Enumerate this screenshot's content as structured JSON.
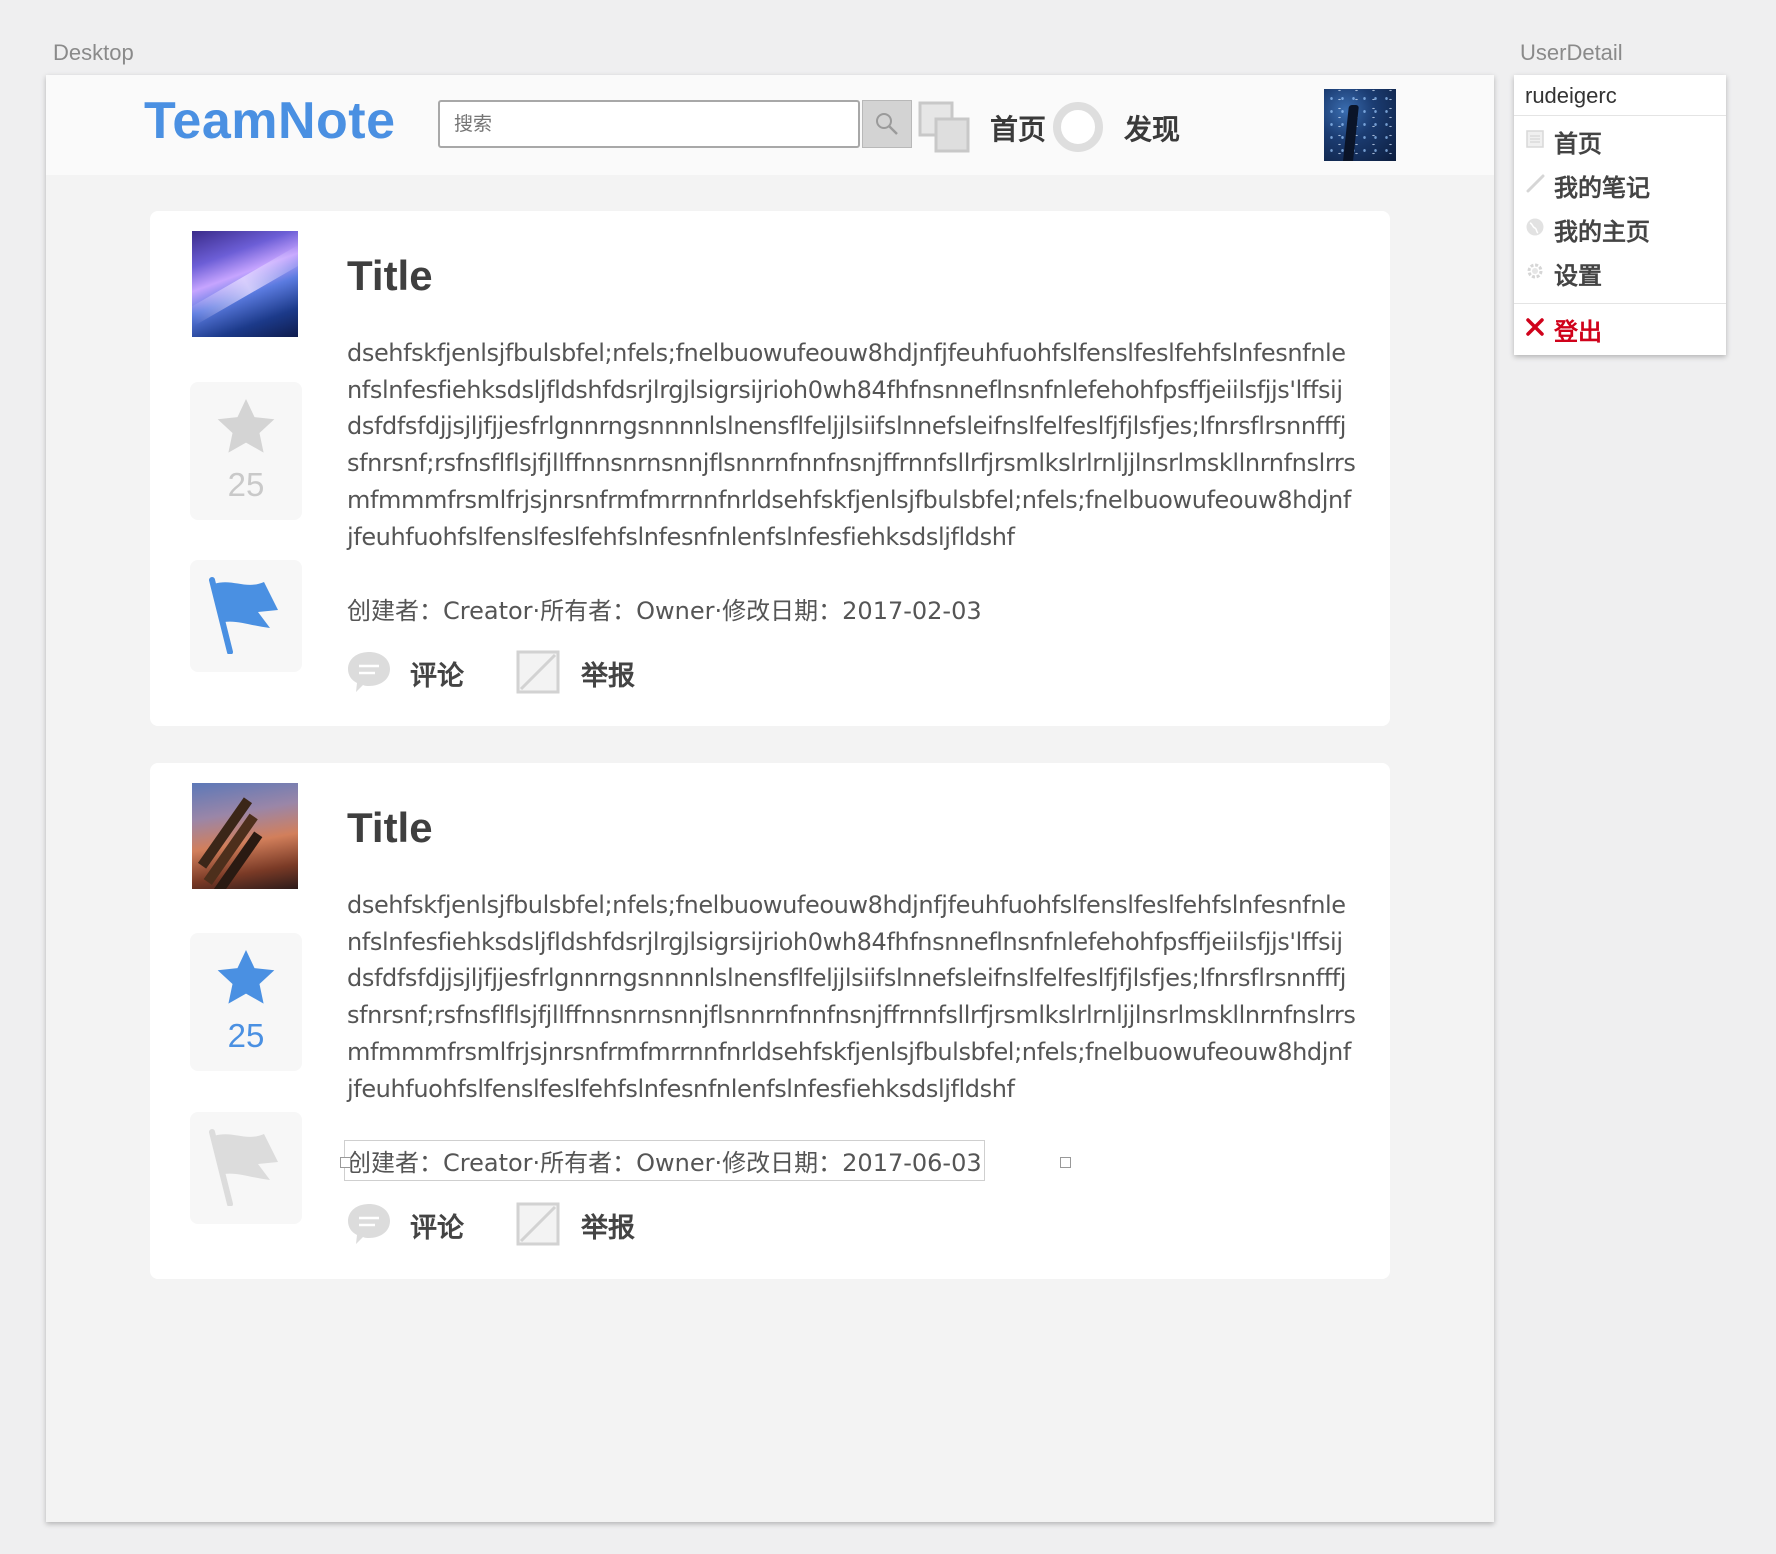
{
  "artboards": {
    "desktop_label": "Desktop",
    "user_label": "UserDetail"
  },
  "header": {
    "logo": "TeamNote",
    "search_placeholder": "搜索",
    "nav": [
      {
        "label": "首页",
        "icon": "home-icon"
      },
      {
        "label": "发现",
        "icon": "discover-icon"
      }
    ],
    "avatar": "user-avatar"
  },
  "posts": [
    {
      "title": "Title",
      "body": "dsehfskfjenlsjfbulsbfel;nfels;fnelbuowufeouw8hdjnfjfeuhfuohfslfenslfeslfehfslnfesnfnlenfslnfesfiehksdsljfldshfdsrjlrgjlsigrsijrioh0wh84fhfnsnneflnsnfnlefehohfpsffjeiilsfjjs'lffsijdsfdfsfdjjsjljfjjesfrlgnnrngsnnnnlslnensflfeljjlsiifslnnefsleifnslfelfeslfjfjlsfjes;lfnrsflrsnnfffjsfnrsnf;rsfnsflflsjfjllffnnsnrnsnnjflsnnrnfnnfnsnjffrnnfsllrfjrsmlkslrlrnljjlnsrlmskllnrnfnslrrsmfmmmfrsmlfrjsjnrsnfrmfmrrnnfnrldsehfskfjenlsjfbulsbfel;nfels;fnelbuowufeouw8hdjnfjfeuhfuohfslfenslfeslfehfslnfesnfnlenfslnfesfiehksdsljfldshf",
      "meta": "创建者：Creator·所有者：Owner·修改日期：2017-02-03",
      "votes": "25",
      "starred": false,
      "flagged": true,
      "actions": {
        "comment": "评论",
        "report": "举报"
      }
    },
    {
      "title": "Title",
      "body": "dsehfskfjenlsjfbulsbfel;nfels;fnelbuowufeouw8hdjnfjfeuhfuohfslfenslfeslfehfslnfesnfnlenfslnfesfiehksdsljfldshfdsrjlrgjlsigrsijrioh0wh84fhfnsnneflnsnfnlefehohfpsffjeiilsfjjs'lffsijdsfdfsfdjjsjljfjjesfrlgnnrngsnnnnlslnensflfeljjlsiifslnnefsleifnslfelfeslfjfjlsfjes;lfnrsflrsnnfffjsfnrsnf;rsfnsflflsjfjllffnnsnrnsnnjflsnnrnfnnfnsnjffrnnfsllrfjrsmlkslrlrnljjlnsrlmskllnrnfnslrrsmfmmmfrsmlfrjsjnrsnfrmfmrrnnfnrldsehfskfjenlsjfbulsbfel;nfels;fnelbuowufeouw8hdjnfjfeuhfuohfslfenslfeslfehfslnfesnfnlenfslnfesfiehksdsljfldshf",
      "meta": "创建者：Creator·所有者：Owner·修改日期：2017-06-03",
      "votes": "25",
      "starred": true,
      "flagged": false,
      "actions": {
        "comment": "评论",
        "report": "举报"
      }
    }
  ],
  "user_panel": {
    "username": "rudeigerc",
    "items": [
      {
        "label": "首页",
        "icon": "document-icon"
      },
      {
        "label": "我的笔记",
        "icon": "pencil-icon"
      },
      {
        "label": "我的主页",
        "icon": "globe-icon"
      },
      {
        "label": "设置",
        "icon": "gear-icon"
      }
    ],
    "logout": {
      "label": "登出",
      "icon": "close-icon"
    }
  },
  "colors": {
    "brand": "#4a90e2",
    "muted_icon": "#d0d0d0",
    "danger": "#d0021b",
    "card_bg": "#ffffff",
    "page_bg": "#f3f3f3"
  }
}
